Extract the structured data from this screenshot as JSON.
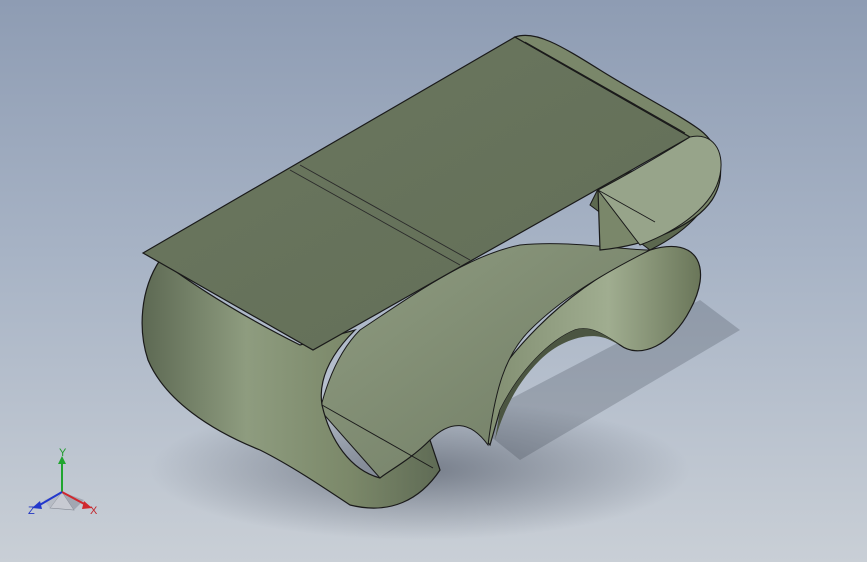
{
  "viewport": {
    "background_top": "#8e9cb3",
    "background_bottom": "#c9cfd6"
  },
  "model": {
    "description_icon": "sheet-metal-clip-part",
    "face_color": "#7d8a6e",
    "face_dark": "#5e6a53",
    "edge_color": "#1a1a1a"
  },
  "triad": {
    "x_label": "X",
    "y_label": "Y",
    "z_label": "Z",
    "x_color": "#d0282e",
    "y_color": "#20a52f",
    "z_color": "#2238cc"
  }
}
